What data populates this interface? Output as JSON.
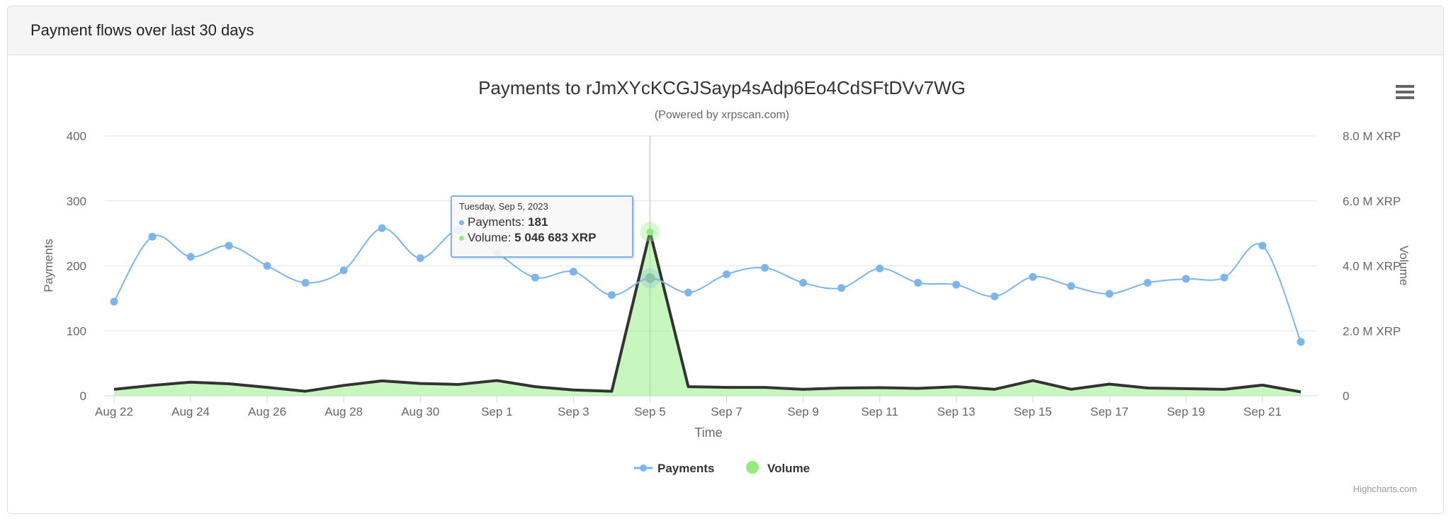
{
  "panel": {
    "title": "Payment flows over last 30 days"
  },
  "menu_icon": "hamburger-menu-icon",
  "credits": "Highcharts.com",
  "tooltip": {
    "date": "Tuesday, Sep 5, 2023",
    "payments_label": "Payments:",
    "payments_value": "181",
    "volume_label": "Volume:",
    "volume_value": "5 046 683 XRP"
  },
  "chart_data": {
    "type": "line",
    "title": "Payments to rJmXYcKCGJSayp4sAdp6Eo4CdSFtDVv7WG",
    "subtitle": "(Powered by xrpscan.com)",
    "xlabel": "Time",
    "ylabel": "Payments",
    "y2label": "Volume",
    "ylim": [
      0,
      400
    ],
    "y2lim": [
      0,
      8000000
    ],
    "yticks": [
      "0",
      "100",
      "200",
      "300",
      "400"
    ],
    "y2ticks": [
      "0",
      "2.0 M XRP",
      "4.0 M XRP",
      "6.0 M XRP",
      "8.0 M XRP"
    ],
    "xticks": [
      "Aug 22",
      "Aug 24",
      "Aug 26",
      "Aug 28",
      "Aug 30",
      "Sep 1",
      "Sep 3",
      "Sep 5",
      "Sep 7",
      "Sep 9",
      "Sep 11",
      "Sep 13",
      "Sep 15",
      "Sep 17",
      "Sep 19",
      "Sep 21"
    ],
    "x": [
      "2023-08-22",
      "2023-08-23",
      "2023-08-24",
      "2023-08-25",
      "2023-08-26",
      "2023-08-27",
      "2023-08-28",
      "2023-08-29",
      "2023-08-30",
      "2023-08-31",
      "2023-09-01",
      "2023-09-02",
      "2023-09-03",
      "2023-09-04",
      "2023-09-05",
      "2023-09-06",
      "2023-09-07",
      "2023-09-08",
      "2023-09-09",
      "2023-09-10",
      "2023-09-11",
      "2023-09-12",
      "2023-09-13",
      "2023-09-14",
      "2023-09-15",
      "2023-09-16",
      "2023-09-17",
      "2023-09-18",
      "2023-09-19",
      "2023-09-20",
      "2023-09-21",
      "2023-09-22"
    ],
    "grid": true,
    "legend_position": "bottom-center",
    "series": [
      {
        "name": "Payments",
        "type": "spline",
        "axis": "left",
        "color": "#7cb5ec",
        "values": [
          145,
          245,
          214,
          231,
          200,
          174,
          193,
          258,
          212,
          255,
          220,
          182,
          191,
          155,
          181,
          159,
          187,
          197,
          174,
          166,
          196,
          174,
          171,
          153,
          183,
          169,
          157,
          174,
          180,
          182,
          231,
          83
        ]
      },
      {
        "name": "Volume",
        "type": "area",
        "axis": "right",
        "color": "#90ed7d",
        "line_color": "#333333",
        "values": [
          200000,
          320000,
          420000,
          370000,
          260000,
          140000,
          320000,
          460000,
          380000,
          350000,
          470000,
          280000,
          180000,
          140000,
          5046683,
          280000,
          260000,
          260000,
          200000,
          240000,
          250000,
          230000,
          280000,
          200000,
          470000,
          200000,
          360000,
          240000,
          220000,
          200000,
          330000,
          120000
        ]
      }
    ],
    "highlighted_index": 14
  }
}
